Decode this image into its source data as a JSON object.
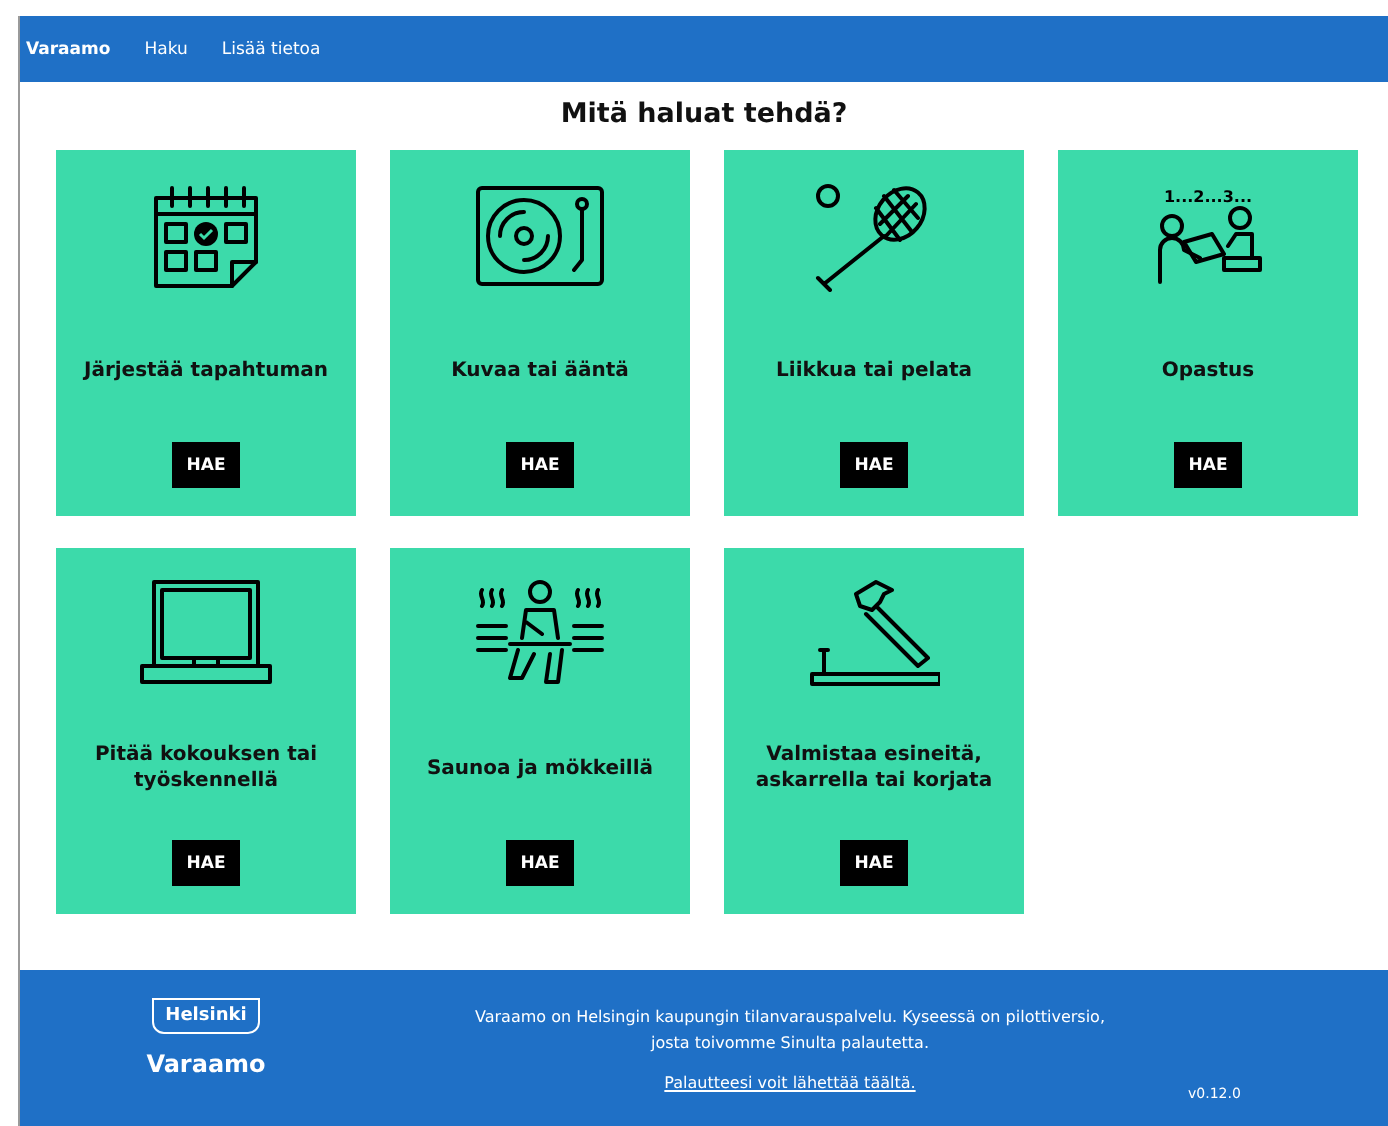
{
  "nav": {
    "brand": "Varaamo",
    "links": [
      "Haku",
      "Lisää tietoa"
    ]
  },
  "heading": "Mitä haluat tehdä?",
  "cards": [
    {
      "title": "Järjestää tapahtuman",
      "button": "HAE"
    },
    {
      "title": "Kuvaa tai ääntä",
      "button": "HAE"
    },
    {
      "title": "Liikkua tai pelata",
      "button": "HAE"
    },
    {
      "title": "Opastus",
      "button": "HAE",
      "icon_text": "1...2...3..."
    },
    {
      "title": "Pitää kokouksen tai työskennellä",
      "button": "HAE"
    },
    {
      "title": "Saunoa ja mökkeillä",
      "button": "HAE"
    },
    {
      "title": "Valmistaa esineitä, askarrella tai korjata",
      "button": "HAE"
    }
  ],
  "footer": {
    "logo": "Helsinki",
    "brand": "Varaamo",
    "text": "Varaamo on Helsingin kaupungin tilanvarauspalvelu. Kyseessä on pilottiversio, josta toivomme Sinulta palautetta.",
    "link": "Palautteesi voit lähettää täältä.",
    "version": "v0.12.0"
  }
}
